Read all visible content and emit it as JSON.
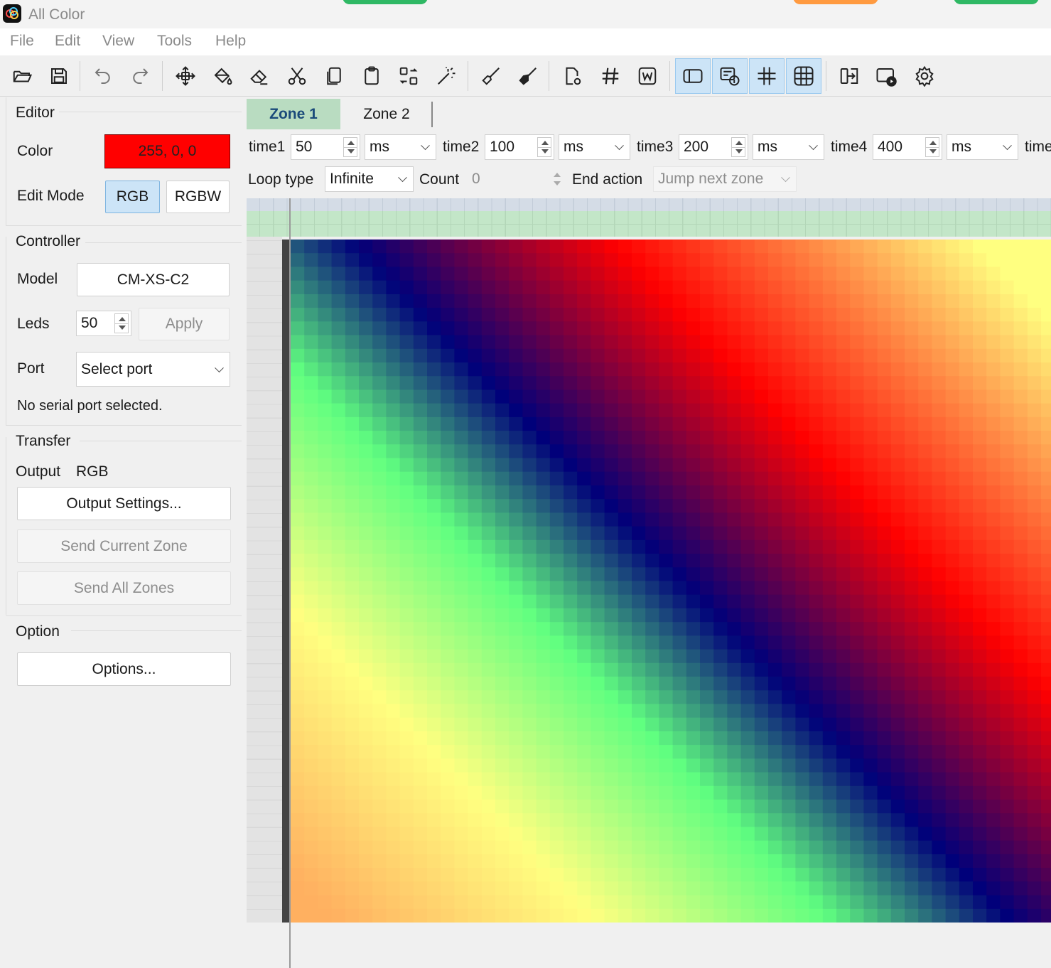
{
  "app": {
    "title": "All Color"
  },
  "menu": [
    "File",
    "Edit",
    "View",
    "Tools",
    "Help"
  ],
  "toolbar": {
    "icons": [
      "open-icon",
      "save-icon",
      "undo-icon",
      "redo-icon",
      "move-icon",
      "fill-icon",
      "eraser-icon",
      "cut-icon",
      "copy-icon",
      "paste-icon",
      "swap-icon",
      "magic-wand-icon",
      "brush-icon",
      "broom-icon",
      "file-settings-icon",
      "grid-hash-icon",
      "word-icon",
      "panel-left-icon",
      "info-panel-icon",
      "grid-align-icon",
      "grid-view-icon",
      "export-icon",
      "record-play-icon",
      "settings-icon"
    ],
    "active": [
      "panel-left-icon",
      "info-panel-icon",
      "grid-align-icon",
      "grid-view-icon"
    ]
  },
  "editor": {
    "group_title": "Editor",
    "color_label": "Color",
    "color_value": "255, 0, 0",
    "color_hex": "#ff0000",
    "edit_mode_label": "Edit Mode",
    "mode_rgb": "RGB",
    "mode_rgbw": "RGBW",
    "mode_selected": "RGB"
  },
  "controller": {
    "group_title": "Controller",
    "model_label": "Model",
    "model_value": "CM-XS-C2",
    "leds_label": "Leds",
    "leds_value": "50",
    "apply_label": "Apply",
    "port_label": "Port",
    "port_value": "Select port",
    "status": "No serial port selected."
  },
  "transfer": {
    "group_title": "Transfer",
    "output_label": "Output",
    "output_value": "RGB",
    "output_settings": "Output Settings...",
    "send_current": "Send Current Zone",
    "send_all": "Send All Zones"
  },
  "option": {
    "group_title": "Option",
    "options_button": "Options..."
  },
  "zones": {
    "tabs": [
      "Zone 1",
      "Zone 2"
    ],
    "active": "Zone 1"
  },
  "timing": {
    "items": [
      {
        "label": "time1",
        "value": "50",
        "unit": "ms"
      },
      {
        "label": "time2",
        "value": "100",
        "unit": "ms"
      },
      {
        "label": "time3",
        "value": "200",
        "unit": "ms"
      },
      {
        "label": "time4",
        "value": "400",
        "unit": "ms"
      },
      {
        "label": "time"
      }
    ],
    "loop_label": "Loop type",
    "loop_value": "Infinite",
    "count_label": "Count",
    "count_value": "0",
    "end_label": "End action",
    "end_value": "Jump next zone"
  },
  "grid": {
    "cols": 56,
    "rows": 50,
    "colormap": [
      "#ffb060",
      "#ffff80",
      "#60ff80",
      "#00007a",
      "#ff0000",
      "#ffff80"
    ]
  }
}
